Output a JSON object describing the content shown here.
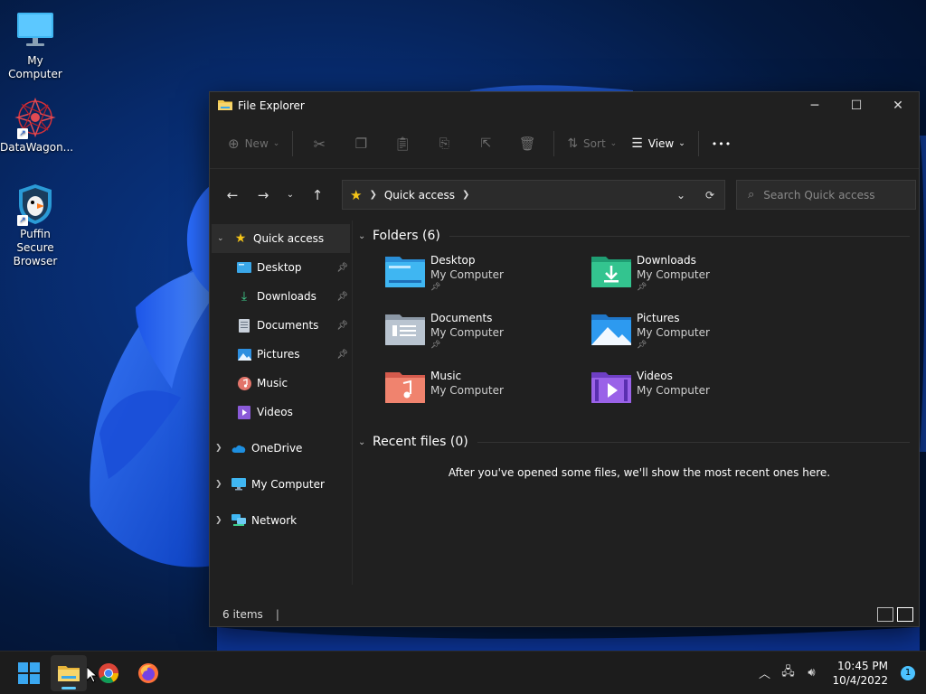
{
  "desktop": {
    "icons": [
      {
        "label": "My Computer",
        "icon": "monitor-icon"
      },
      {
        "label": "DataWagon...",
        "icon": "datawagon-icon"
      },
      {
        "label": "Puffin Secure Browser",
        "icon": "puffin-icon"
      }
    ]
  },
  "window": {
    "title": "File Explorer",
    "controls": {
      "minimize": "─",
      "maximize": "☐",
      "close": "✕"
    }
  },
  "toolbar": {
    "new_label": "New",
    "sort_label": "Sort",
    "view_label": "View",
    "more_label": "•••"
  },
  "navigation": {
    "back": "←",
    "forward": "→",
    "recent": "⌄",
    "up": "↑",
    "address_crumb": "Quick access",
    "search_placeholder": "Search Quick access"
  },
  "sidebar": {
    "quick_access": "Quick access",
    "pinned": [
      {
        "label": "Desktop",
        "pinned": true
      },
      {
        "label": "Downloads",
        "pinned": true
      },
      {
        "label": "Documents",
        "pinned": true
      },
      {
        "label": "Pictures",
        "pinned": true
      },
      {
        "label": "Music",
        "pinned": false
      },
      {
        "label": "Videos",
        "pinned": false
      }
    ],
    "onedrive": "OneDrive",
    "my_computer": "My Computer",
    "network": "Network"
  },
  "content": {
    "folders_heading": "Folders (6)",
    "folders": [
      {
        "name": "Desktop",
        "location": "My Computer",
        "pinned": true
      },
      {
        "name": "Downloads",
        "location": "My Computer",
        "pinned": true
      },
      {
        "name": "Documents",
        "location": "My Computer",
        "pinned": true
      },
      {
        "name": "Pictures",
        "location": "My Computer",
        "pinned": true
      },
      {
        "name": "Music",
        "location": "My Computer",
        "pinned": false
      },
      {
        "name": "Videos",
        "location": "My Computer",
        "pinned": false
      }
    ],
    "recent_heading": "Recent files (0)",
    "recent_message": "After you've opened some files, we'll show the most recent ones here."
  },
  "status": {
    "items": "6 items",
    "separator": "|"
  },
  "taskbar": {
    "time": "10:45 PM",
    "date": "10/4/2022",
    "notifications": "1"
  },
  "colors": {
    "accent": "#60cdff",
    "window_bg": "#202020",
    "taskbar_bg": "#1c1c1c"
  }
}
